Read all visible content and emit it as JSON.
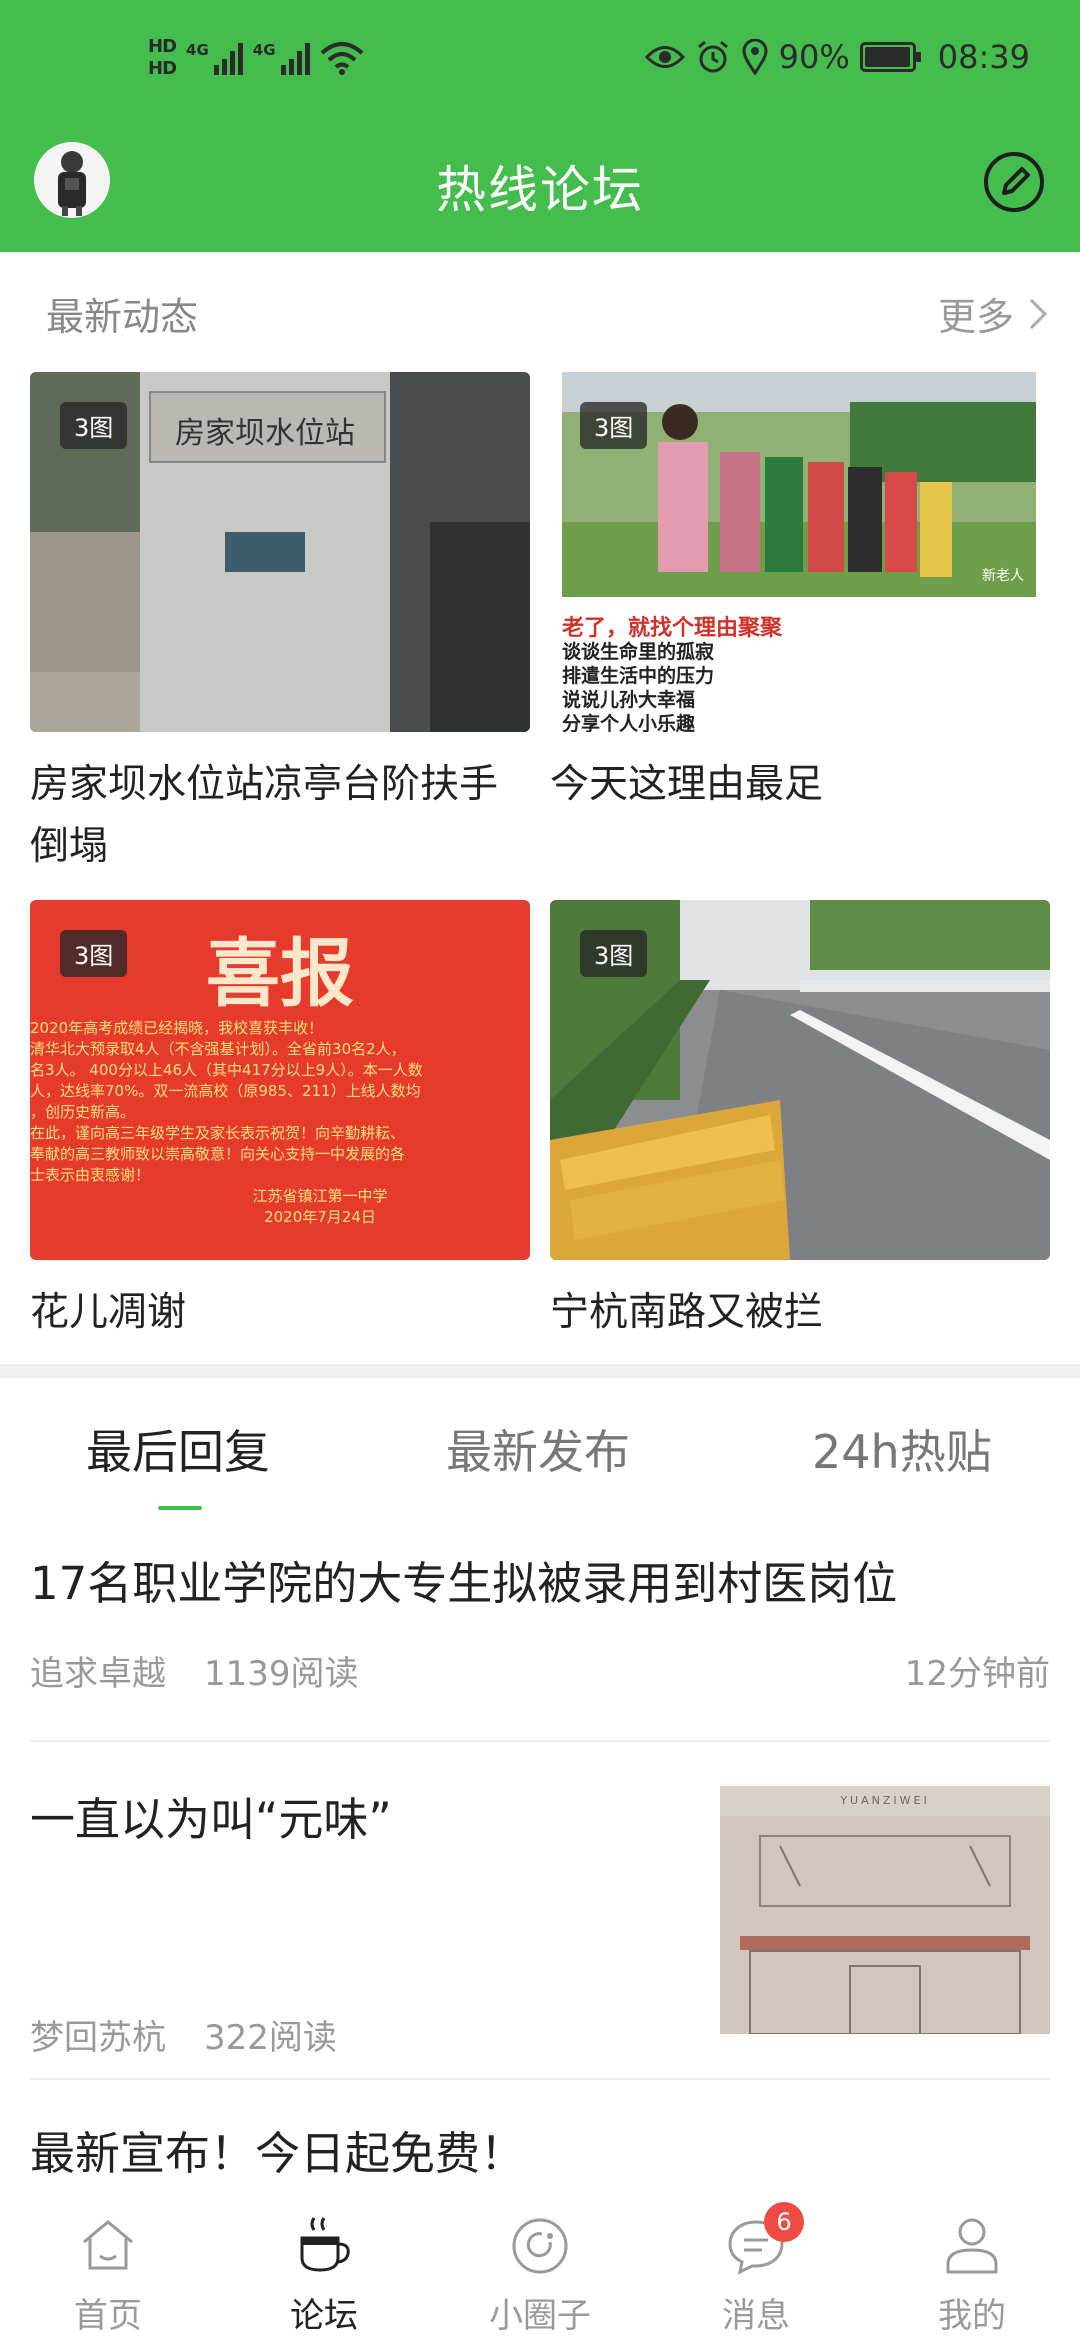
{
  "status_bar": {
    "network_left": [
      "HD",
      "HD"
    ],
    "net_type_1": "4G",
    "net_type_2": "4G",
    "battery": "90%",
    "battery_level": 0.9,
    "time": "08:39"
  },
  "header": {
    "title": "热线论坛",
    "avatar_icon": "user-avatar",
    "compose_icon": "pencil-icon"
  },
  "latest": {
    "label": "最新动态",
    "more": "更多",
    "cards": [
      {
        "badge": "3图",
        "caption": "房家坝水位站凉亭台阶扶手倒塌",
        "image_text": "房家坝水位站"
      },
      {
        "badge": "3图",
        "caption": "今天这理由最足",
        "image_text": "老了，就找个理由聚聚",
        "image_lines": [
          "谈谈生命里的孤寂",
          "排遣生活中的压力",
          "说说儿孙大幸福",
          "分享个人小乐趣"
        ],
        "watermark": "新老人"
      },
      {
        "badge": "3图",
        "caption": "花儿凋谢",
        "image_text": "喜报",
        "image_lines": [
          "2020年高考成绩已经揭晓，我校喜获丰收！",
          "清华北大预录取4人（不含强基计划）。全省前30名2人，",
          "名3人。 400分以上46人（其中417分以上9人）。本一人数",
          "人，达线率70%。双一流高校（原985、211）上线人数均",
          "，创历史新高。",
          "在此，谨向高三年级学生及家长表示祝贺！向辛勤耕耘、",
          "奉献的高三教师致以崇高敬意！向关心支持一中发展的各",
          "士表示由衷感谢！",
          "江苏省镇江第一中学",
          "2020年7月24日"
        ]
      },
      {
        "badge": "3图",
        "caption": "宁杭南路又被拦"
      }
    ]
  },
  "tabs": [
    {
      "label": "最后回复",
      "active": true
    },
    {
      "label": "最新发布",
      "active": false
    },
    {
      "label": "24h热贴",
      "active": false
    }
  ],
  "posts": [
    {
      "title": "17名职业学院的大专生拟被录用到村医岗位",
      "author": "追求卓越",
      "reads": "1139阅读",
      "time": "12分钟前"
    },
    {
      "title": "一直以为叫“元味”",
      "author": "梦回苏杭",
      "reads": "322阅读",
      "thumb_text": "YUANZIWEI"
    },
    {
      "title": "最新宣布！今日起免费！"
    }
  ],
  "nav": [
    {
      "label": "首页",
      "icon": "home-icon",
      "active": false
    },
    {
      "label": "论坛",
      "icon": "coffee-cup-icon",
      "active": true
    },
    {
      "label": "小圈子",
      "icon": "circle-icon",
      "active": false
    },
    {
      "label": "消息",
      "icon": "chat-bubble-icon",
      "active": false,
      "badge": "6"
    },
    {
      "label": "我的",
      "icon": "person-icon",
      "active": false
    }
  ],
  "colors": {
    "brand_green": "#44bd4e",
    "badge_red": "#f04a45"
  }
}
